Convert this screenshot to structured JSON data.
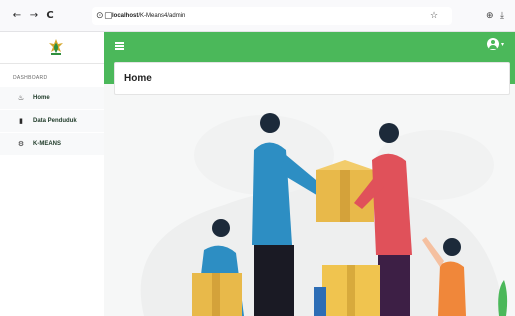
{
  "browser": {
    "back_icon": "←",
    "forward_icon": "→",
    "reload_icon": "C",
    "url_host": "localhost",
    "url_path": "/K-Means4/admin",
    "bookmark_icon": "☆",
    "shield_icon": "⊕",
    "download_icon": "⤓"
  },
  "sidebar": {
    "heading": "DASHBOARD",
    "items": [
      {
        "label": "Home",
        "icon": "flame-icon",
        "glyph": "♨"
      },
      {
        "label": "Data Penduduk",
        "icon": "file-icon",
        "glyph": "▮"
      },
      {
        "label": "K-MEANS",
        "icon": "cogs-icon",
        "glyph": "⚙"
      }
    ]
  },
  "main": {
    "title": "Home"
  },
  "colors": {
    "accent": "#4bb85a",
    "sidebar_text": "#1f3b29"
  }
}
